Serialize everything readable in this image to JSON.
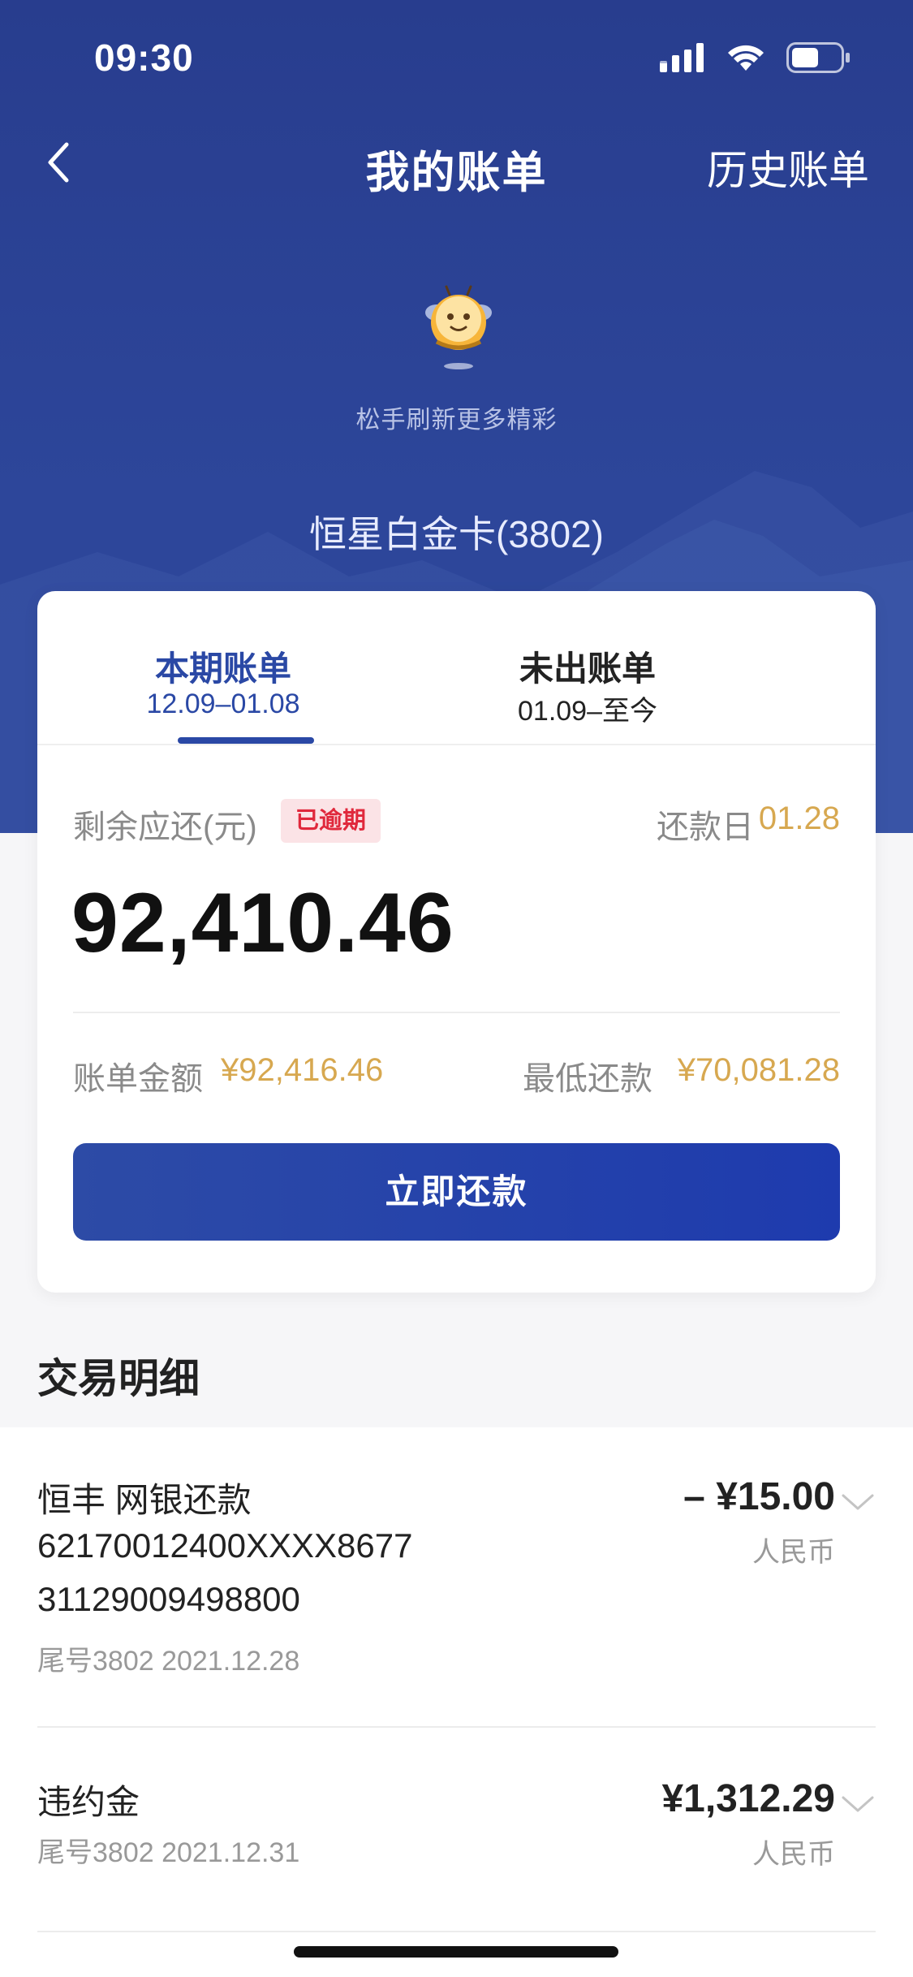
{
  "status_bar": {
    "time": "09:30"
  },
  "nav": {
    "title": "我的账单",
    "history_label": "历史账单"
  },
  "refresh_hint": "松手刷新更多精彩",
  "card_name": "恒星白金卡(3802)",
  "bill_card": {
    "tabs": [
      {
        "title": "本期账单",
        "range": "12.09–01.08",
        "active": true
      },
      {
        "title": "未出账单",
        "range": "01.09–至今",
        "active": false
      }
    ],
    "remain_label": "剩余应还(元)",
    "overdue_badge": "已逾期",
    "due_label": "还款日",
    "due_date": "01.28",
    "remain_amount": "92,410.46",
    "bill_amount_label": "账单金额",
    "bill_amount_value": "¥92,416.46",
    "min_payment_label": "最低还款",
    "min_payment_value": "¥70,081.28",
    "pay_button": "立即还款"
  },
  "transactions": {
    "section_title": "交易明细",
    "items": [
      {
        "lines": [
          "恒丰 网银还款",
          "62170012400XXXX8677",
          "31129009498800"
        ],
        "sub": "尾号3802 2021.12.28",
        "amount": "– ¥15.00",
        "currency": "人民币"
      },
      {
        "lines": [
          "违约金"
        ],
        "sub": "尾号3802 2021.12.31",
        "amount": "¥1,312.29",
        "currency": "人民币"
      }
    ]
  },
  "colors": {
    "hero_blue": "#2d469a",
    "accent_blue": "#2a48a5",
    "gold": "#d7a850",
    "overdue_red": "#e0283c"
  }
}
